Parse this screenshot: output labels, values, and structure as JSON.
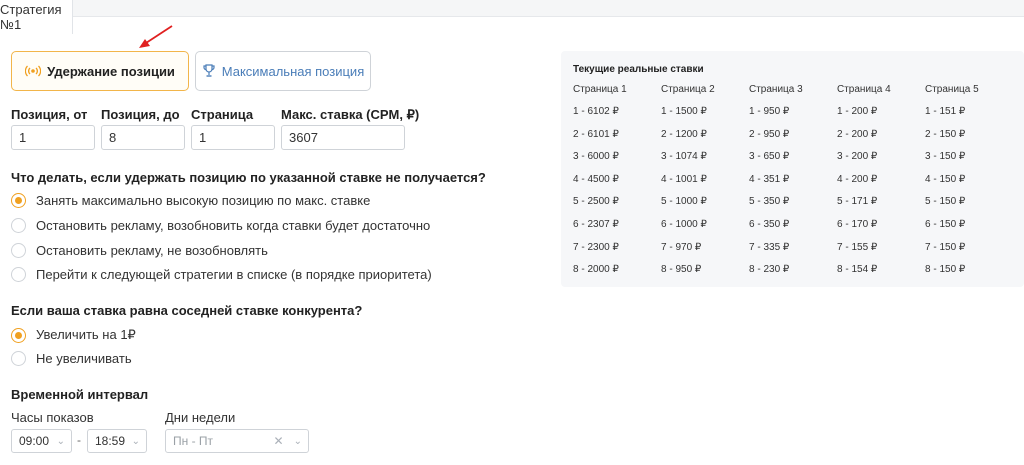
{
  "tab": {
    "label": "Стратегия №1"
  },
  "strategy_buttons": {
    "hold_label": "Удержание позиции",
    "max_label": "Максимальная позиция",
    "selected": "hold"
  },
  "fields": [
    {
      "label": "Позиция, от",
      "value": "1"
    },
    {
      "label": "Позиция, до",
      "value": "8"
    },
    {
      "label": "Страница",
      "value": "1"
    },
    {
      "label": "Макс. ставка (CPM, ₽)",
      "value": "3607"
    }
  ],
  "question1": {
    "text": "Что делать, если удержать позицию по указанной ставке не получается?",
    "options": [
      "Занять максимально высокую позицию по макс. ставке",
      "Остановить рекламу, возобновить когда ставки будет достаточно",
      "Остановить рекламу, не возобновлять",
      "Перейти к следующей стратегии в списке (в порядке приоритета)"
    ],
    "selected_index": 0
  },
  "question2": {
    "text": "Если ваша ставка равна соседней ставке конкурента?",
    "options": [
      "Увеличить на 1₽",
      "Не увеличивать"
    ],
    "selected_index": 0
  },
  "interval": {
    "title": "Временной интервал",
    "hours_label": "Часы показов",
    "hours_from": "09:00",
    "hours_to": "18:59",
    "separator": "-",
    "days_label": "Дни недели",
    "days_placeholder": "Пн - Пт"
  },
  "bids": {
    "title": "Текущие реальные ставки",
    "columns": [
      {
        "header": "Страница 1",
        "rows": [
          "1 - 6102 ₽",
          "2 - 6101 ₽",
          "3 - 6000 ₽",
          "4 - 4500 ₽",
          "5 - 2500 ₽",
          "6 - 2307 ₽",
          "7 - 2300 ₽",
          "8 - 2000 ₽"
        ]
      },
      {
        "header": "Страница 2",
        "rows": [
          "1 - 1500 ₽",
          "2 - 1200 ₽",
          "3 - 1074 ₽",
          "4 - 1001 ₽",
          "5 - 1000 ₽",
          "6 - 1000 ₽",
          "7 - 970 ₽",
          "8 - 950 ₽"
        ]
      },
      {
        "header": "Страница 3",
        "rows": [
          "1 - 950 ₽",
          "2 - 950 ₽",
          "3 - 650 ₽",
          "4 - 351 ₽",
          "5 - 350 ₽",
          "6 - 350 ₽",
          "7 - 335 ₽",
          "8 - 230 ₽"
        ]
      },
      {
        "header": "Страница 4",
        "rows": [
          "1 - 200 ₽",
          "2 - 200 ₽",
          "3 - 200 ₽",
          "4 - 200 ₽",
          "5 - 171 ₽",
          "6 - 170 ₽",
          "7 - 155 ₽",
          "8 - 154 ₽"
        ]
      },
      {
        "header": "Страница 5",
        "rows": [
          "1 - 151 ₽",
          "2 - 150 ₽",
          "3 - 150 ₽",
          "4 - 150 ₽",
          "5 - 150 ₽",
          "6 - 150 ₽",
          "7 - 150 ₽",
          "8 - 150 ₽"
        ]
      }
    ]
  },
  "icons": {
    "hold": "broadcast-icon",
    "max": "trophy-icon",
    "annotation": "red-arrow-icon"
  },
  "colors": {
    "accent": "#f0a020",
    "link": "#4a7db8",
    "arrow": "#e02020"
  }
}
